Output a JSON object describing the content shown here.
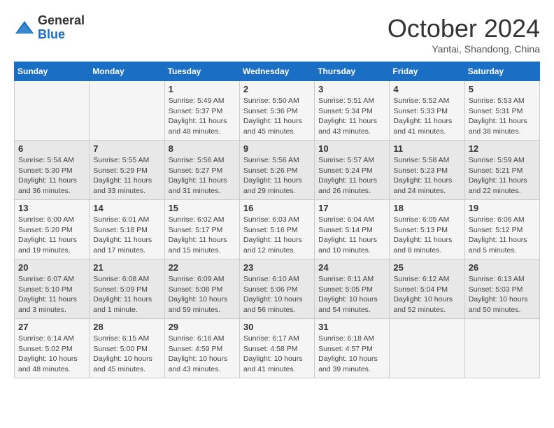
{
  "logo": {
    "general": "General",
    "blue": "Blue"
  },
  "header": {
    "month": "October 2024",
    "location": "Yantai, Shandong, China"
  },
  "weekdays": [
    "Sunday",
    "Monday",
    "Tuesday",
    "Wednesday",
    "Thursday",
    "Friday",
    "Saturday"
  ],
  "weeks": [
    [
      {
        "day": "",
        "detail": ""
      },
      {
        "day": "",
        "detail": ""
      },
      {
        "day": "1",
        "detail": "Sunrise: 5:49 AM\nSunset: 5:37 PM\nDaylight: 11 hours and 48 minutes."
      },
      {
        "day": "2",
        "detail": "Sunrise: 5:50 AM\nSunset: 5:36 PM\nDaylight: 11 hours and 45 minutes."
      },
      {
        "day": "3",
        "detail": "Sunrise: 5:51 AM\nSunset: 5:34 PM\nDaylight: 11 hours and 43 minutes."
      },
      {
        "day": "4",
        "detail": "Sunrise: 5:52 AM\nSunset: 5:33 PM\nDaylight: 11 hours and 41 minutes."
      },
      {
        "day": "5",
        "detail": "Sunrise: 5:53 AM\nSunset: 5:31 PM\nDaylight: 11 hours and 38 minutes."
      }
    ],
    [
      {
        "day": "6",
        "detail": "Sunrise: 5:54 AM\nSunset: 5:30 PM\nDaylight: 11 hours and 36 minutes."
      },
      {
        "day": "7",
        "detail": "Sunrise: 5:55 AM\nSunset: 5:29 PM\nDaylight: 11 hours and 33 minutes."
      },
      {
        "day": "8",
        "detail": "Sunrise: 5:56 AM\nSunset: 5:27 PM\nDaylight: 11 hours and 31 minutes."
      },
      {
        "day": "9",
        "detail": "Sunrise: 5:56 AM\nSunset: 5:26 PM\nDaylight: 11 hours and 29 minutes."
      },
      {
        "day": "10",
        "detail": "Sunrise: 5:57 AM\nSunset: 5:24 PM\nDaylight: 11 hours and 26 minutes."
      },
      {
        "day": "11",
        "detail": "Sunrise: 5:58 AM\nSunset: 5:23 PM\nDaylight: 11 hours and 24 minutes."
      },
      {
        "day": "12",
        "detail": "Sunrise: 5:59 AM\nSunset: 5:21 PM\nDaylight: 11 hours and 22 minutes."
      }
    ],
    [
      {
        "day": "13",
        "detail": "Sunrise: 6:00 AM\nSunset: 5:20 PM\nDaylight: 11 hours and 19 minutes."
      },
      {
        "day": "14",
        "detail": "Sunrise: 6:01 AM\nSunset: 5:18 PM\nDaylight: 11 hours and 17 minutes."
      },
      {
        "day": "15",
        "detail": "Sunrise: 6:02 AM\nSunset: 5:17 PM\nDaylight: 11 hours and 15 minutes."
      },
      {
        "day": "16",
        "detail": "Sunrise: 6:03 AM\nSunset: 5:16 PM\nDaylight: 11 hours and 12 minutes."
      },
      {
        "day": "17",
        "detail": "Sunrise: 6:04 AM\nSunset: 5:14 PM\nDaylight: 11 hours and 10 minutes."
      },
      {
        "day": "18",
        "detail": "Sunrise: 6:05 AM\nSunset: 5:13 PM\nDaylight: 11 hours and 8 minutes."
      },
      {
        "day": "19",
        "detail": "Sunrise: 6:06 AM\nSunset: 5:12 PM\nDaylight: 11 hours and 5 minutes."
      }
    ],
    [
      {
        "day": "20",
        "detail": "Sunrise: 6:07 AM\nSunset: 5:10 PM\nDaylight: 11 hours and 3 minutes."
      },
      {
        "day": "21",
        "detail": "Sunrise: 6:08 AM\nSunset: 5:09 PM\nDaylight: 11 hours and 1 minute."
      },
      {
        "day": "22",
        "detail": "Sunrise: 6:09 AM\nSunset: 5:08 PM\nDaylight: 10 hours and 59 minutes."
      },
      {
        "day": "23",
        "detail": "Sunrise: 6:10 AM\nSunset: 5:06 PM\nDaylight: 10 hours and 56 minutes."
      },
      {
        "day": "24",
        "detail": "Sunrise: 6:11 AM\nSunset: 5:05 PM\nDaylight: 10 hours and 54 minutes."
      },
      {
        "day": "25",
        "detail": "Sunrise: 6:12 AM\nSunset: 5:04 PM\nDaylight: 10 hours and 52 minutes."
      },
      {
        "day": "26",
        "detail": "Sunrise: 6:13 AM\nSunset: 5:03 PM\nDaylight: 10 hours and 50 minutes."
      }
    ],
    [
      {
        "day": "27",
        "detail": "Sunrise: 6:14 AM\nSunset: 5:02 PM\nDaylight: 10 hours and 48 minutes."
      },
      {
        "day": "28",
        "detail": "Sunrise: 6:15 AM\nSunset: 5:00 PM\nDaylight: 10 hours and 45 minutes."
      },
      {
        "day": "29",
        "detail": "Sunrise: 6:16 AM\nSunset: 4:59 PM\nDaylight: 10 hours and 43 minutes."
      },
      {
        "day": "30",
        "detail": "Sunrise: 6:17 AM\nSunset: 4:58 PM\nDaylight: 10 hours and 41 minutes."
      },
      {
        "day": "31",
        "detail": "Sunrise: 6:18 AM\nSunset: 4:57 PM\nDaylight: 10 hours and 39 minutes."
      },
      {
        "day": "",
        "detail": ""
      },
      {
        "day": "",
        "detail": ""
      }
    ]
  ]
}
